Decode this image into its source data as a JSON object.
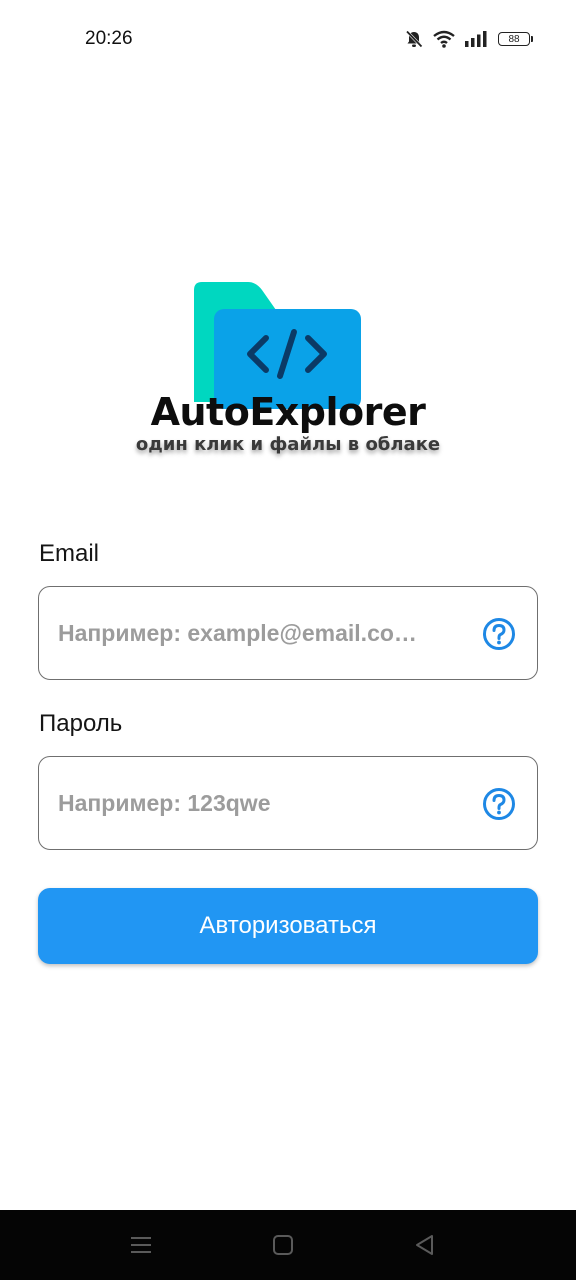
{
  "status_bar": {
    "time": "20:26",
    "battery": "88",
    "icons": [
      "bell-off-icon",
      "wifi-icon",
      "signal-icon",
      "battery-icon"
    ]
  },
  "logo": {
    "title": "AutoExplorer",
    "tagline": "один клик и файлы в облаке",
    "icon": "folder-code-icon",
    "colors": {
      "folder_back": "#00d7c0",
      "folder_front": "#0aa2e8",
      "code_symbol": "#0b3a66"
    }
  },
  "form": {
    "email": {
      "label": "Email",
      "placeholder": "Например: example@email.co…",
      "value": "",
      "help_icon": "help-circle-icon"
    },
    "password": {
      "label": "Пароль",
      "placeholder": "Например: 123qwe",
      "value": "",
      "help_icon": "help-circle-icon"
    },
    "submit_label": "Авторизоваться"
  },
  "nav_bar": {
    "buttons": [
      "menu-icon",
      "home-icon",
      "back-icon"
    ]
  },
  "colors": {
    "accent": "#2196f3",
    "help_icon": "#1e88e5",
    "background": "#ffffff",
    "nav_bar": "#050505"
  }
}
